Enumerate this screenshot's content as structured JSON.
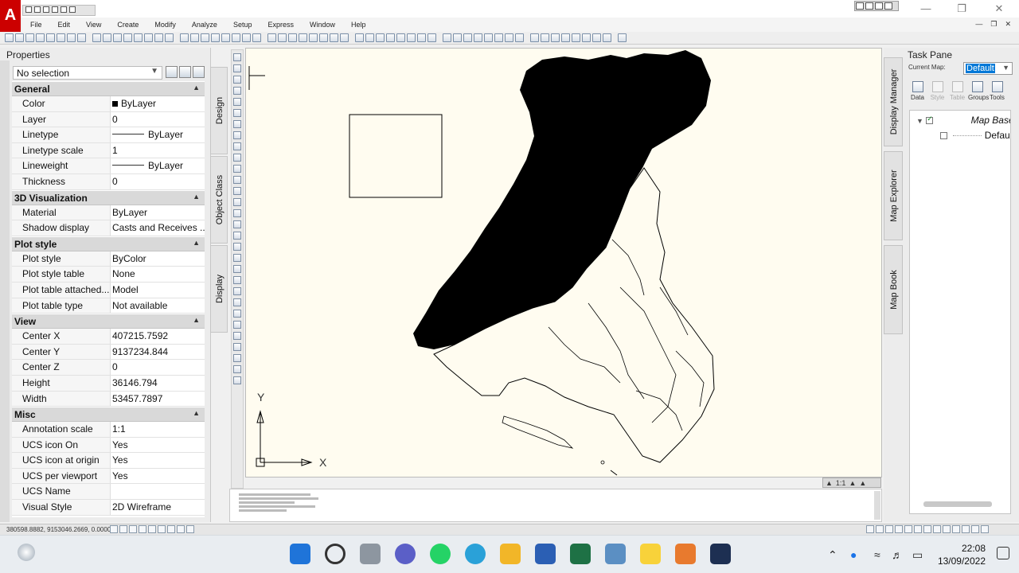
{
  "app": {
    "logo_letter": "A"
  },
  "menu": {
    "items": [
      "File",
      "Edit",
      "View",
      "Create",
      "Modify",
      "Analyze",
      "Setup",
      "Express",
      "Window",
      "Help"
    ]
  },
  "properties": {
    "title": "Properties",
    "selection": "No selection",
    "sections": [
      {
        "name": "General",
        "rows": [
          {
            "key": "Color",
            "value": "ByLayer",
            "swatch": true
          },
          {
            "key": "Layer",
            "value": "0"
          },
          {
            "key": "Linetype",
            "value": "ByLayer",
            "line": true
          },
          {
            "key": "Linetype scale",
            "value": "1"
          },
          {
            "key": "Lineweight",
            "value": "ByLayer",
            "line": true
          },
          {
            "key": "Thickness",
            "value": "0"
          }
        ]
      },
      {
        "name": "3D Visualization",
        "rows": [
          {
            "key": "Material",
            "value": "ByLayer"
          },
          {
            "key": "Shadow display",
            "value": "Casts and Receives ..."
          }
        ]
      },
      {
        "name": "Plot style",
        "rows": [
          {
            "key": "Plot style",
            "value": "ByColor"
          },
          {
            "key": "Plot style table",
            "value": "None"
          },
          {
            "key": "Plot table attached...",
            "value": "Model"
          },
          {
            "key": "Plot table type",
            "value": "Not available"
          }
        ]
      },
      {
        "name": "View",
        "rows": [
          {
            "key": "Center X",
            "value": "407215.7592"
          },
          {
            "key": "Center Y",
            "value": "9137234.844"
          },
          {
            "key": "Center Z",
            "value": "0"
          },
          {
            "key": "Height",
            "value": "36146.794"
          },
          {
            "key": "Width",
            "value": "53457.7897"
          }
        ]
      },
      {
        "name": "Misc",
        "rows": [
          {
            "key": "Annotation scale",
            "value": "1:1"
          },
          {
            "key": "UCS icon On",
            "value": "Yes"
          },
          {
            "key": "UCS icon at origin",
            "value": "Yes"
          },
          {
            "key": "UCS per viewport",
            "value": "Yes"
          },
          {
            "key": "UCS Name",
            "value": ""
          },
          {
            "key": "Visual Style",
            "value": "2D Wireframe"
          }
        ]
      }
    ],
    "side_tabs": [
      "Design",
      "Object Class",
      "Display"
    ]
  },
  "canvas": {
    "ucs_y": "Y",
    "ucs_x": "X",
    "annotation_scale": "1:1"
  },
  "taskpane": {
    "title": "Task Pane",
    "current_map_label": "Current Map:",
    "current_map_value": "Default",
    "tools": [
      {
        "label": "Data",
        "enabled": true
      },
      {
        "label": "Style",
        "enabled": false
      },
      {
        "label": "Table",
        "enabled": false
      },
      {
        "label": "Groups",
        "enabled": true
      },
      {
        "label": "Tools",
        "enabled": true
      }
    ],
    "tree": {
      "root": "Map Base",
      "child": "Default"
    },
    "side_tabs": [
      "Display Manager",
      "Map Explorer",
      "Map Book"
    ]
  },
  "status": {
    "coords": "380598.8882, 9153046.2669, 0.0000"
  },
  "taskbar": {
    "time": "22:08",
    "date": "13/09/2022",
    "apps": [
      "start",
      "search",
      "task-view",
      "meet",
      "whatsapp",
      "edge",
      "file-explorer",
      "word",
      "excel",
      "photos",
      "sticky-notes",
      "snipping",
      "autocad-map"
    ]
  }
}
